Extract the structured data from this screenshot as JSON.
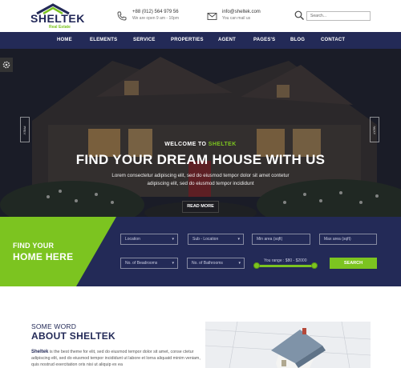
{
  "brand": {
    "name": "SHELTEK",
    "tagline": "Real Estate"
  },
  "contact": {
    "phone": "+88 (012) 564 979 56",
    "phone_hours": "We are open 9 am - 10pm",
    "email": "info@sheltek.com",
    "email_note": "You can mail us"
  },
  "search": {
    "placeholder": "Search..."
  },
  "nav": [
    "HOME",
    "ELEMENTS",
    "SERVICE",
    "PROPERTIES",
    "AGENT",
    "PAGES'S",
    "BLOG",
    "CONTACT"
  ],
  "hero": {
    "welcome_prefix": "WELCOME TO",
    "welcome_brand": "SHELTEK",
    "headline": "FIND YOUR DREAM HOUSE WITH US",
    "lead": "Lorem consectetur adipiscing elit, sed do eiusmod tempor dolor sit amet contetur adipiscing elit, sed do eiusmod tempor incididunt",
    "button": "READ MORE",
    "prev": "PREV",
    "next": "NEXT"
  },
  "finder": {
    "title_line1": "FIND YOUR",
    "title_line2": "HOME HERE",
    "location": "Location",
    "sub_location": "Sub - Location",
    "min_area": "Min area (sqft)",
    "max_area": "Max area (sqft)",
    "bedrooms": "No. of Beadrooms",
    "bathrooms": "No. of Bathrooms",
    "range_label": "You range : $80 - $2000",
    "search_button": "SEARCH"
  },
  "about": {
    "kicker": "SOME WORD",
    "title": "ABOUT SHELTEK",
    "text_brand": "Sheltek",
    "text": " is the best theme for elit, sed do eiusmod tempor dolor sit amet, conse ctetur adipiscing elit, sed do eiusmod tempor incididunt ut labore et lorna aliquatd minim veniam, quis nostrud exercitation oris nisi ut aliquip ex ea"
  },
  "colors": {
    "navy": "#232a57",
    "green": "#7cc420"
  }
}
